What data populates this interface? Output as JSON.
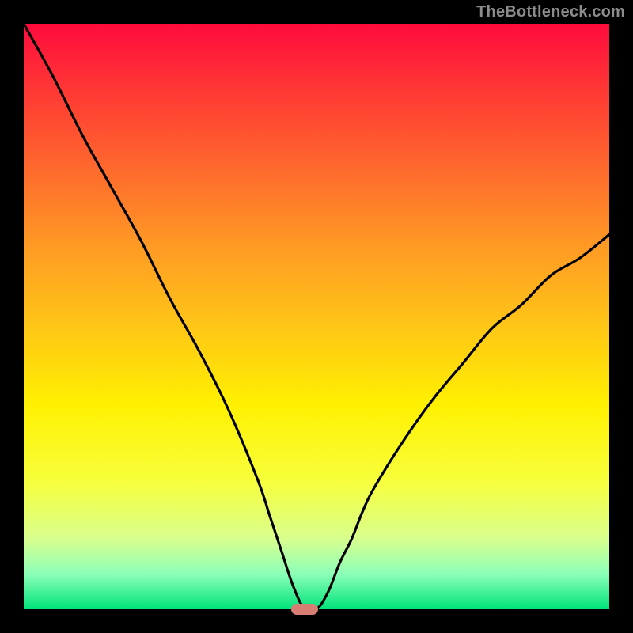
{
  "watermark": "TheBottleneck.com",
  "chart_data": {
    "type": "line",
    "title": "",
    "xlabel": "",
    "ylabel": "",
    "xlim": [
      0,
      100
    ],
    "ylim": [
      0,
      100
    ],
    "x": [
      0,
      5,
      10,
      15,
      20,
      25,
      30,
      35,
      40,
      42,
      44,
      46,
      48,
      50,
      52,
      54,
      56,
      58,
      60,
      65,
      70,
      75,
      80,
      85,
      90,
      95,
      100
    ],
    "y": [
      100,
      91,
      81,
      72,
      63,
      53,
      44,
      34,
      22,
      16,
      10,
      4,
      0,
      0,
      3,
      8,
      12,
      17,
      21,
      29,
      36,
      42,
      48,
      52,
      57,
      60,
      64
    ],
    "minimum_x": 48,
    "marker": {
      "x": 48,
      "y": 0,
      "color": "#d67d74"
    },
    "background_gradient": [
      "#ff0b3d",
      "#ff6a2d",
      "#ffc716",
      "#fff000",
      "#8bffb8",
      "#00e37a"
    ]
  }
}
